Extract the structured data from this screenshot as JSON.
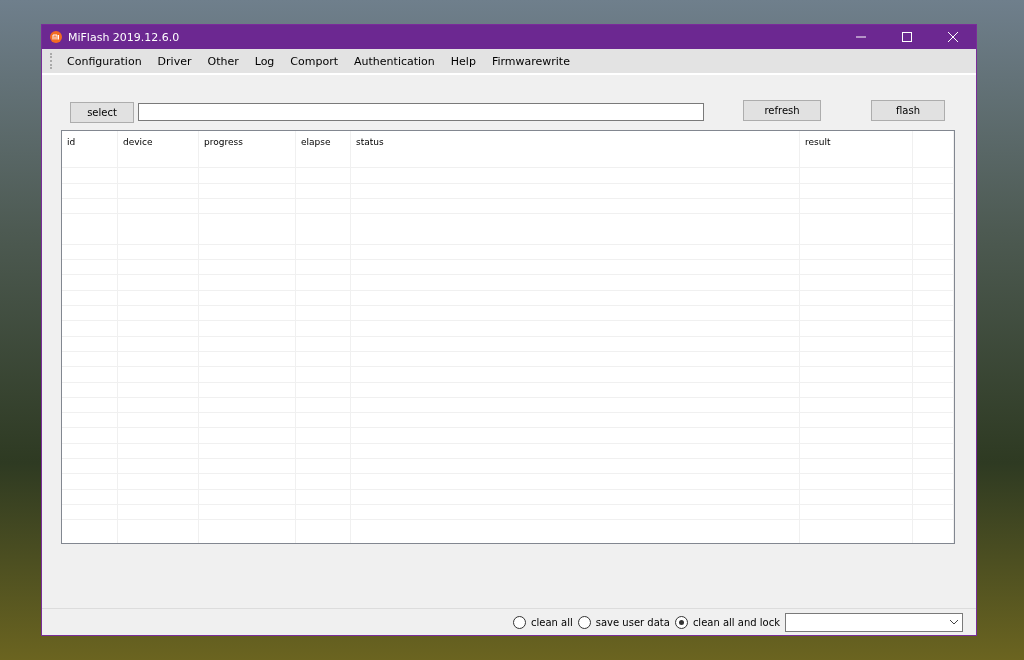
{
  "window": {
    "title": "MiFlash 2019.12.6.0"
  },
  "menu": [
    "Configuration",
    "Driver",
    "Other",
    "Log",
    "Comport",
    "Authentication",
    "Help",
    "Firmwarewrite"
  ],
  "toolbar": {
    "select_button": "select",
    "refresh_button": "refresh",
    "flash_button": "flash"
  },
  "table": {
    "columns": [
      "id",
      "device",
      "progress",
      "elapse",
      "status",
      "result"
    ]
  },
  "status_bar": {
    "options": [
      {
        "label": "clean all",
        "selected": false
      },
      {
        "label": "save user data",
        "selected": false
      },
      {
        "label": "clean all and lock",
        "selected": true
      }
    ]
  }
}
